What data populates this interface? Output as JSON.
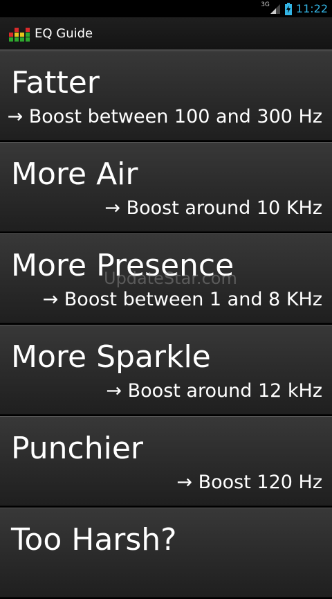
{
  "status_bar": {
    "network": "3G",
    "time": "11:22"
  },
  "app": {
    "title": "EQ Guide"
  },
  "items": [
    {
      "title": "Fatter",
      "desc": "→ Boost between 100 and 300 Hz"
    },
    {
      "title": "More Air",
      "desc": "→ Boost around 10 KHz"
    },
    {
      "title": "More Presence",
      "desc": "→ Boost between 1 and 8 KHz"
    },
    {
      "title": "More Sparkle",
      "desc": "→ Boost around 12 kHz"
    },
    {
      "title": "Punchier",
      "desc": "→ Boost 120 Hz"
    },
    {
      "title": "Too Harsh?",
      "desc": ""
    }
  ],
  "watermark": "UpdateStar.com",
  "colors": {
    "accent": "#33b5e5",
    "item_bg": "#2a2a2a",
    "text": "#ffffff"
  }
}
